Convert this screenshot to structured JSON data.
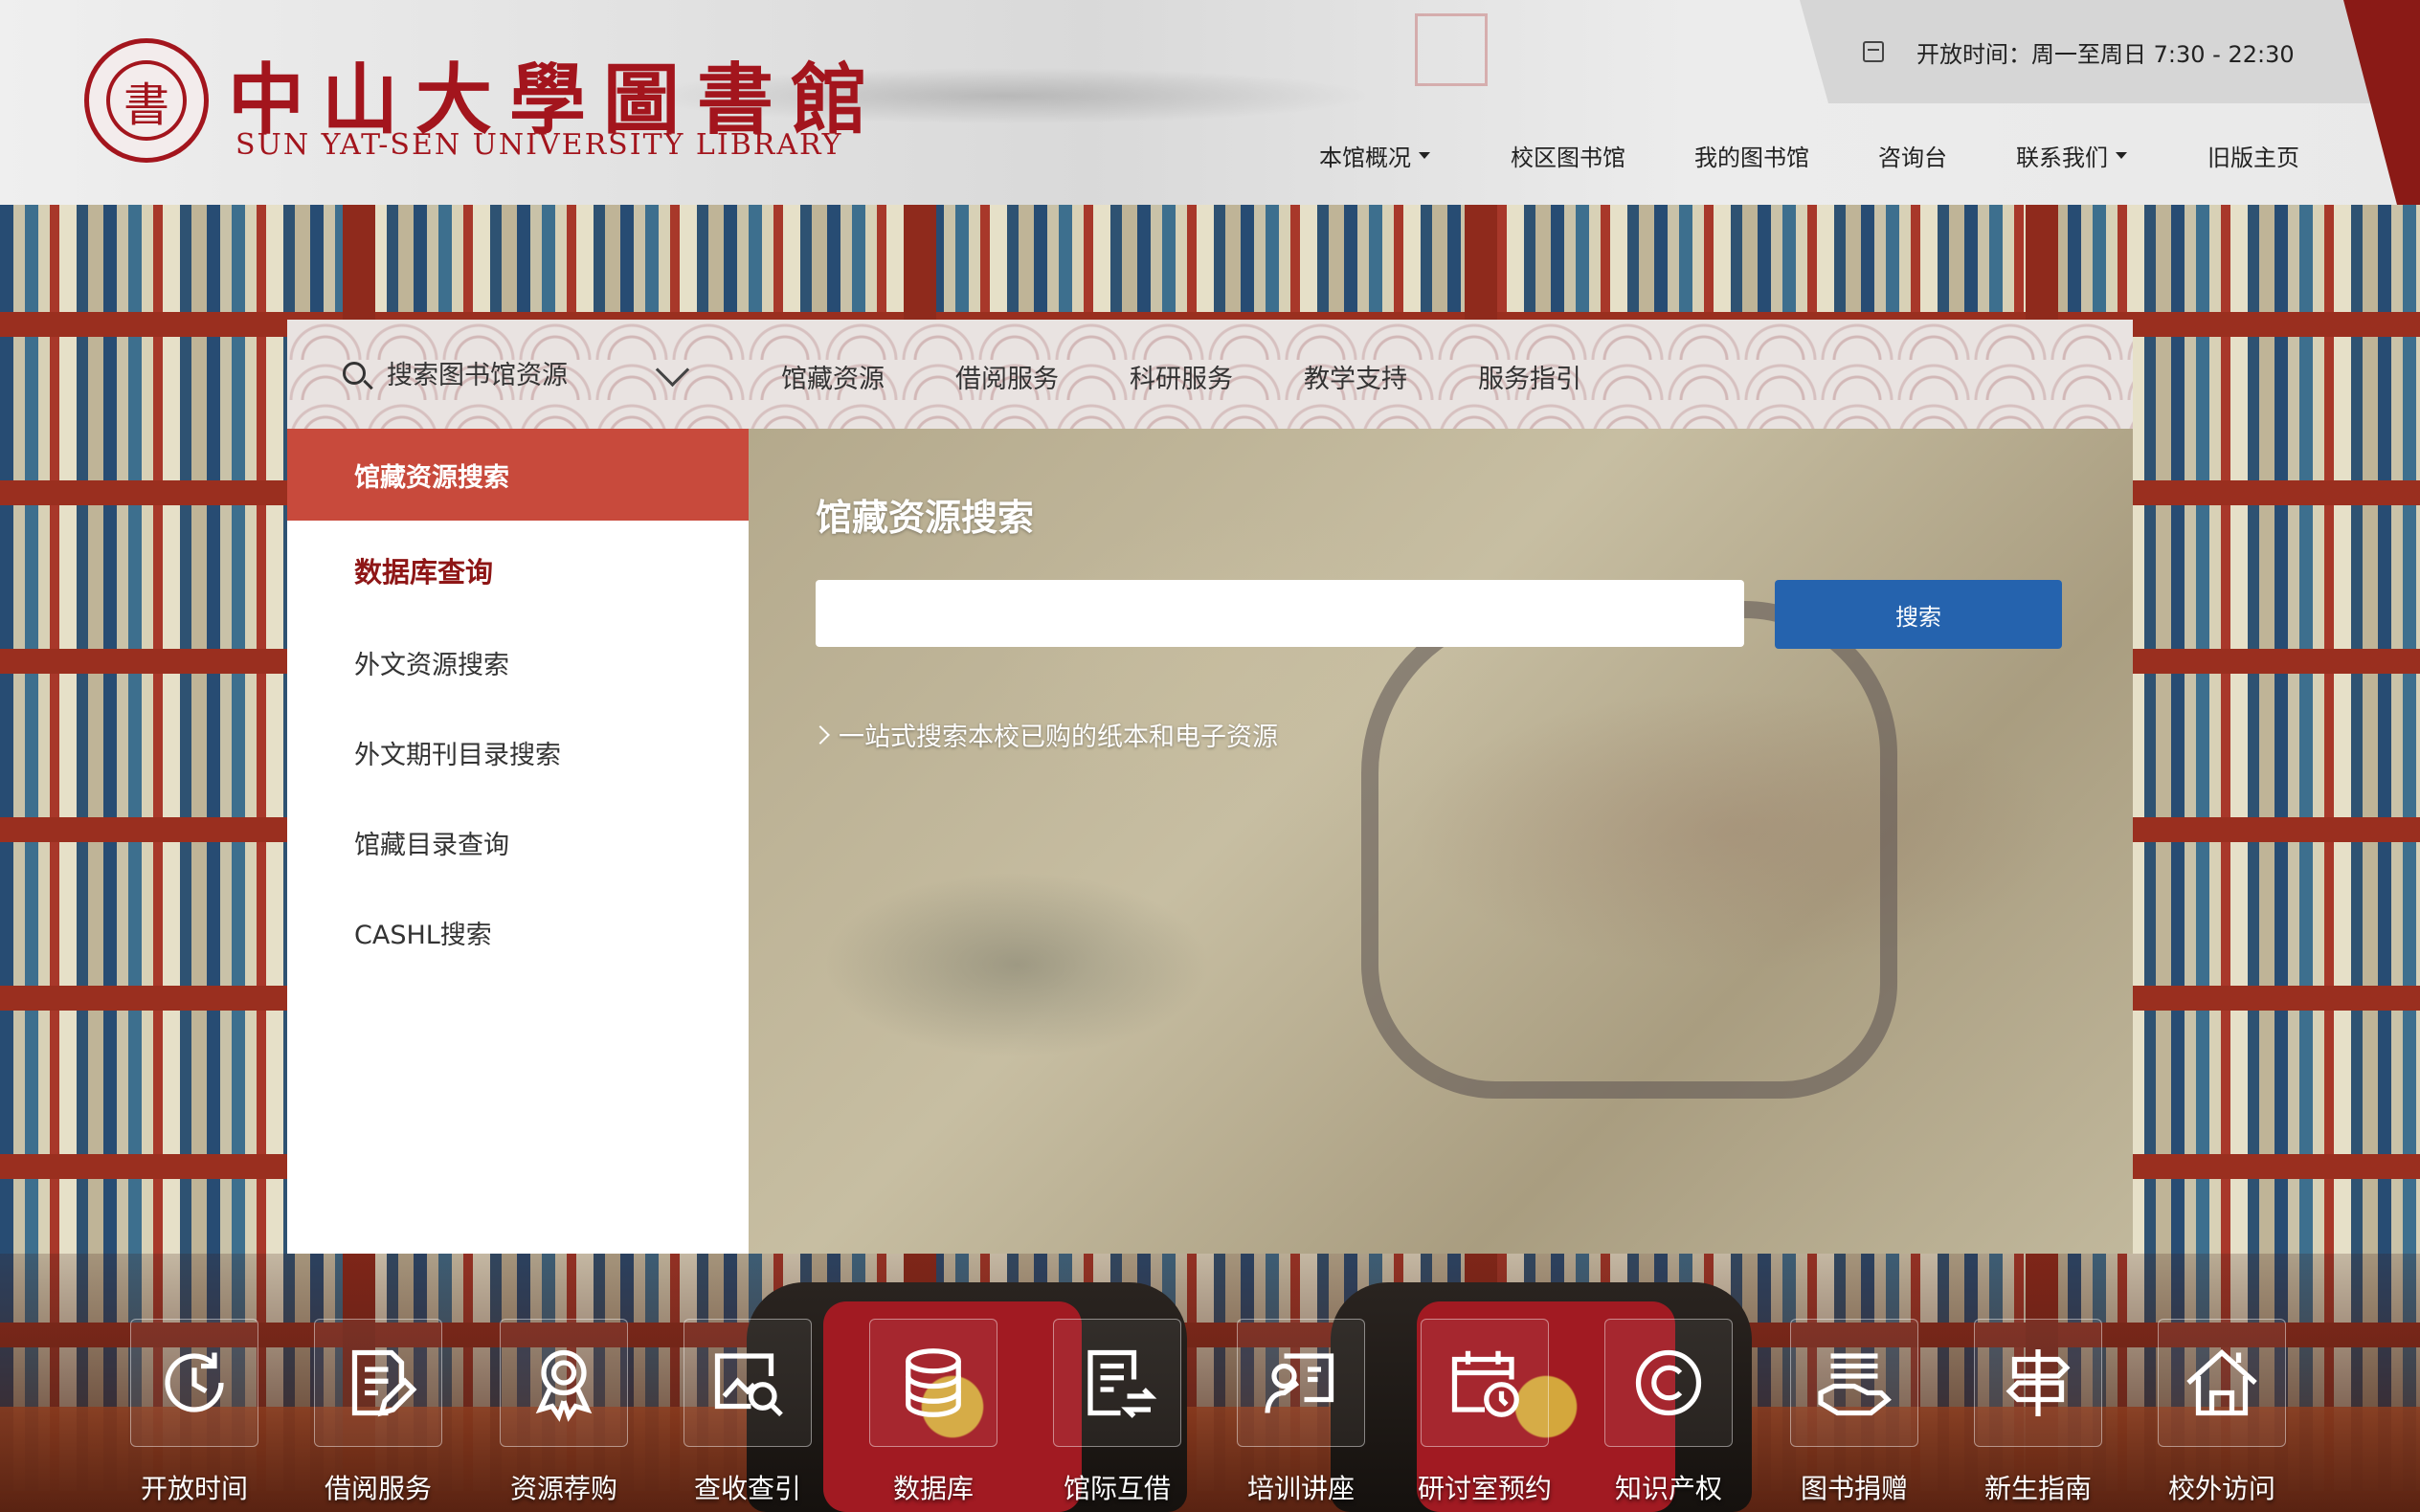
{
  "header": {
    "logo_cn": "中山大學圖書館",
    "logo_en": "SUN YAT-SEN UNIVERSITY LIBRARY",
    "logo_seal_char": "書",
    "hours": "开放时间：周一至周日 7:30 - 22:30",
    "nav": [
      {
        "label": "本馆概况",
        "has_dropdown": true
      },
      {
        "label": "校区图书馆",
        "has_dropdown": false
      },
      {
        "label": "我的图书馆",
        "has_dropdown": false
      },
      {
        "label": "咨询台",
        "has_dropdown": false
      },
      {
        "label": "联系我们",
        "has_dropdown": true
      },
      {
        "label": "旧版主页",
        "has_dropdown": false
      }
    ]
  },
  "panel": {
    "search_selector": "搜索图书馆资源",
    "tabs": [
      "馆藏资源",
      "借阅服务",
      "科研服务",
      "教学支持",
      "服务指引"
    ],
    "side_items": [
      "馆藏资源搜索",
      "数据库查询",
      "外文资源搜索",
      "外文期刊目录搜索",
      "馆藏目录查询",
      "CASHL搜索"
    ],
    "active_side": "馆藏资源搜索",
    "title": "馆藏资源搜索",
    "input_value": "",
    "search_button": "搜索",
    "description": "一站式搜索本校已购的纸本和电子资源"
  },
  "quick_links": [
    {
      "label": "开放时间",
      "icon": "clock-refresh-icon"
    },
    {
      "label": "借阅服务",
      "icon": "document-edit-icon"
    },
    {
      "label": "资源荐购",
      "icon": "award-ribbon-icon"
    },
    {
      "label": "查收查引",
      "icon": "image-search-icon"
    },
    {
      "label": "数据库",
      "icon": "database-icon"
    },
    {
      "label": "馆际互借",
      "icon": "document-exchange-icon"
    },
    {
      "label": "培训讲座",
      "icon": "presenter-board-icon"
    },
    {
      "label": "研讨室预约",
      "icon": "calendar-clock-icon"
    },
    {
      "label": "知识产权",
      "icon": "copyright-icon"
    },
    {
      "label": "图书捐赠",
      "icon": "hand-books-icon"
    },
    {
      "label": "新生指南",
      "icon": "signpost-icon"
    },
    {
      "label": "校外访问",
      "icon": "home-network-icon"
    }
  ],
  "colors": {
    "brand_red": "#a3151d",
    "active_tab": "#c84a3c",
    "highlight_text": "#8e1616",
    "search_button": "#2563ae"
  }
}
